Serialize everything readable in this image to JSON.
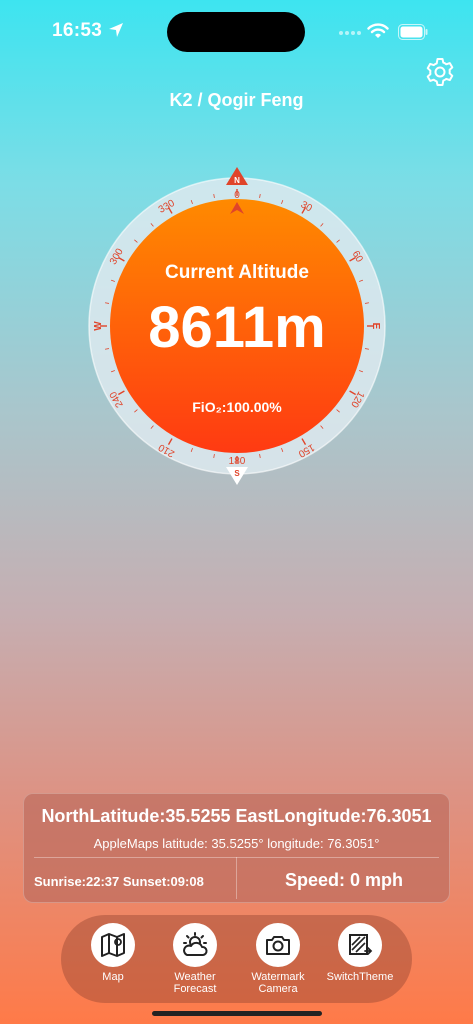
{
  "status_bar": {
    "time": "16:53",
    "icons": [
      "location-arrow-icon",
      "signal-dots-icon",
      "wifi-icon",
      "battery-icon"
    ]
  },
  "header": {
    "title": "K2 / Qogir Feng",
    "settings_icon": "gear-icon"
  },
  "compass": {
    "heading_label": "Current Altitude",
    "altitude": "8611m",
    "fio2": "FiO₂:100.00%",
    "north_mark": "N",
    "south_mark": "S",
    "east_mark": "E",
    "west_mark": "W",
    "degree_labels": [
      "0",
      "30",
      "60",
      "120",
      "150",
      "180",
      "210",
      "240",
      "300",
      "330"
    ],
    "colors": {
      "face_top": "#ff8a00",
      "face_bottom": "#ff3a12",
      "ring": "#dde9ee",
      "accent": "#e0442a"
    }
  },
  "location_panel": {
    "coordinates": "NorthLatitude:35.5255 EastLongitude:76.3051",
    "apple_maps": "AppleMaps latitude: 35.5255° longitude: 76.3051°",
    "sun_times": "Sunrise:22:37 Sunset:09:08",
    "speed": "Speed: 0 mph"
  },
  "dock": {
    "items": [
      {
        "label": "Map",
        "icon": "map-icon"
      },
      {
        "label": "Weather\nForecast",
        "icon": "weather-icon"
      },
      {
        "label": "Watermark\nCamera",
        "icon": "camera-icon"
      },
      {
        "label": "SwitchTheme",
        "icon": "switch-theme-icon"
      }
    ]
  }
}
